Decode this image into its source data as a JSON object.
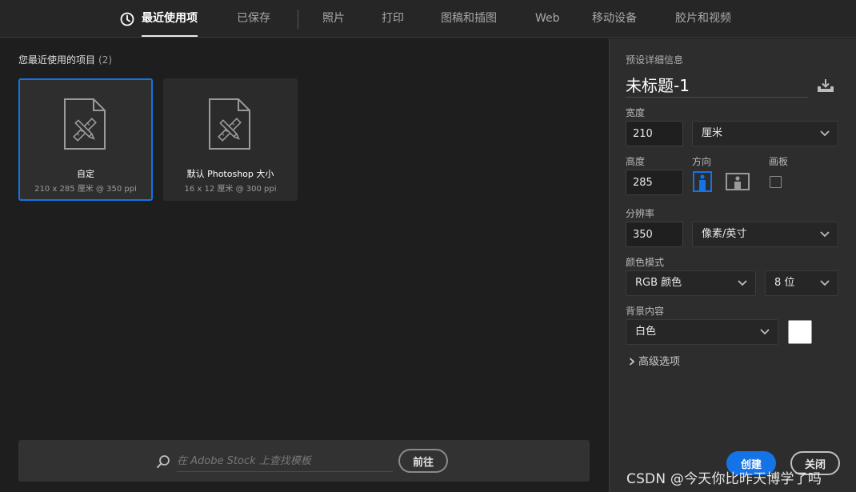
{
  "tabs": [
    {
      "label": "最近使用项",
      "active": true
    },
    {
      "label": "已保存"
    },
    {
      "label": "照片"
    },
    {
      "label": "打印"
    },
    {
      "label": "图稿和插图"
    },
    {
      "label": "Web"
    },
    {
      "label": "移动设备"
    },
    {
      "label": "胶片和视频"
    }
  ],
  "recent": {
    "title": "您最近使用的项目",
    "count": "(2)",
    "items": [
      {
        "name": "自定",
        "desc": "210 x 285 厘米 @ 350 ppi",
        "selected": true
      },
      {
        "name": "默认 Photoshop 大小",
        "desc": "16 x 12 厘米 @ 300 ppi",
        "selected": false
      }
    ]
  },
  "stock": {
    "placeholder": "在 Adobe Stock 上查找模板",
    "go_label": "前往"
  },
  "preset": {
    "heading": "预设详细信息",
    "name": "未标题-1",
    "width_label": "宽度",
    "width_value": "210",
    "width_unit": "厘米",
    "height_label": "高度",
    "height_value": "285",
    "orientation_label": "方向",
    "artboard_label": "画板",
    "resolution_label": "分辨率",
    "resolution_value": "350",
    "resolution_unit": "像素/英寸",
    "color_mode_label": "颜色模式",
    "color_mode": "RGB 颜色",
    "bit_depth": "8 位",
    "background_label": "背景内容",
    "background": "白色",
    "background_color": "#ffffff",
    "advanced_label": "高级选项",
    "create_label": "创建",
    "close_label": "关闭"
  },
  "watermark": "CSDN @今天你比昨天博学了吗",
  "colors": {
    "accent": "#1473e6",
    "panel": "#2d2d2d",
    "background": "#1e1e1e"
  },
  "icons": {
    "recent_tab": "clock-icon",
    "document": "document-pencil-ruler-icon",
    "search": "search-icon",
    "save_preset": "save-preset-icon",
    "portrait": "portrait-orientation-icon",
    "landscape": "landscape-orientation-icon"
  }
}
